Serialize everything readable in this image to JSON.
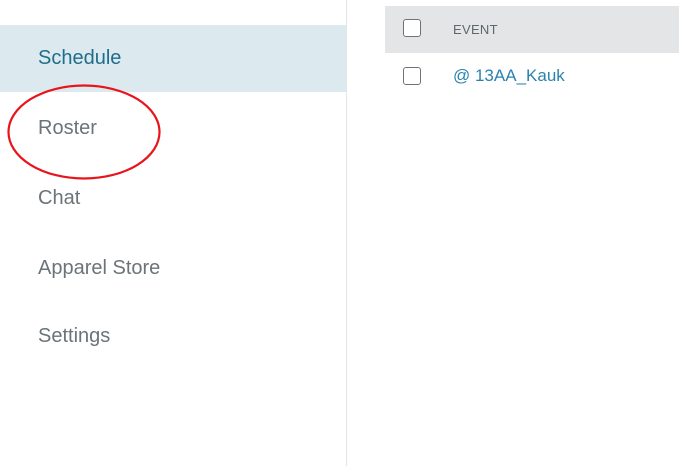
{
  "sidebar": {
    "items": [
      {
        "label": "Schedule",
        "active": true
      },
      {
        "label": "Roster",
        "active": false
      },
      {
        "label": "Chat",
        "active": false
      },
      {
        "label": "Apparel Store",
        "active": false
      },
      {
        "label": "Settings",
        "active": false
      }
    ]
  },
  "table": {
    "header": {
      "column_event": "EVENT"
    },
    "rows": [
      {
        "event": "@ 13AA_Kauk"
      }
    ]
  },
  "colors": {
    "active_bg": "#dce9ef",
    "active_text": "#1f6e8c",
    "nav_text": "#6b7478",
    "link": "#2a83ad",
    "header_bg": "#e3e5e6",
    "annotation": "#e8141b"
  },
  "icons": {
    "checkbox": "checkbox-icon"
  }
}
